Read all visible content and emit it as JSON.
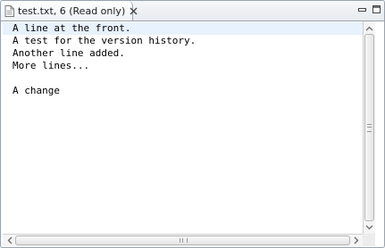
{
  "tab": {
    "title": "test.txt, 6 (Read only)",
    "file_icon": "text-file-icon",
    "close_icon": "close-icon"
  },
  "window_controls": {
    "minimize_icon": "minimize-icon",
    "maximize_icon": "maximize-icon"
  },
  "editor": {
    "lines": [
      "A line at the front.",
      "A test for the version history.",
      "Another line added.",
      "More lines...",
      "",
      "A change"
    ],
    "current_line_color": "#e8f2fe"
  },
  "colors": {
    "border": "#9aa3ad",
    "background": "#ffffff"
  }
}
